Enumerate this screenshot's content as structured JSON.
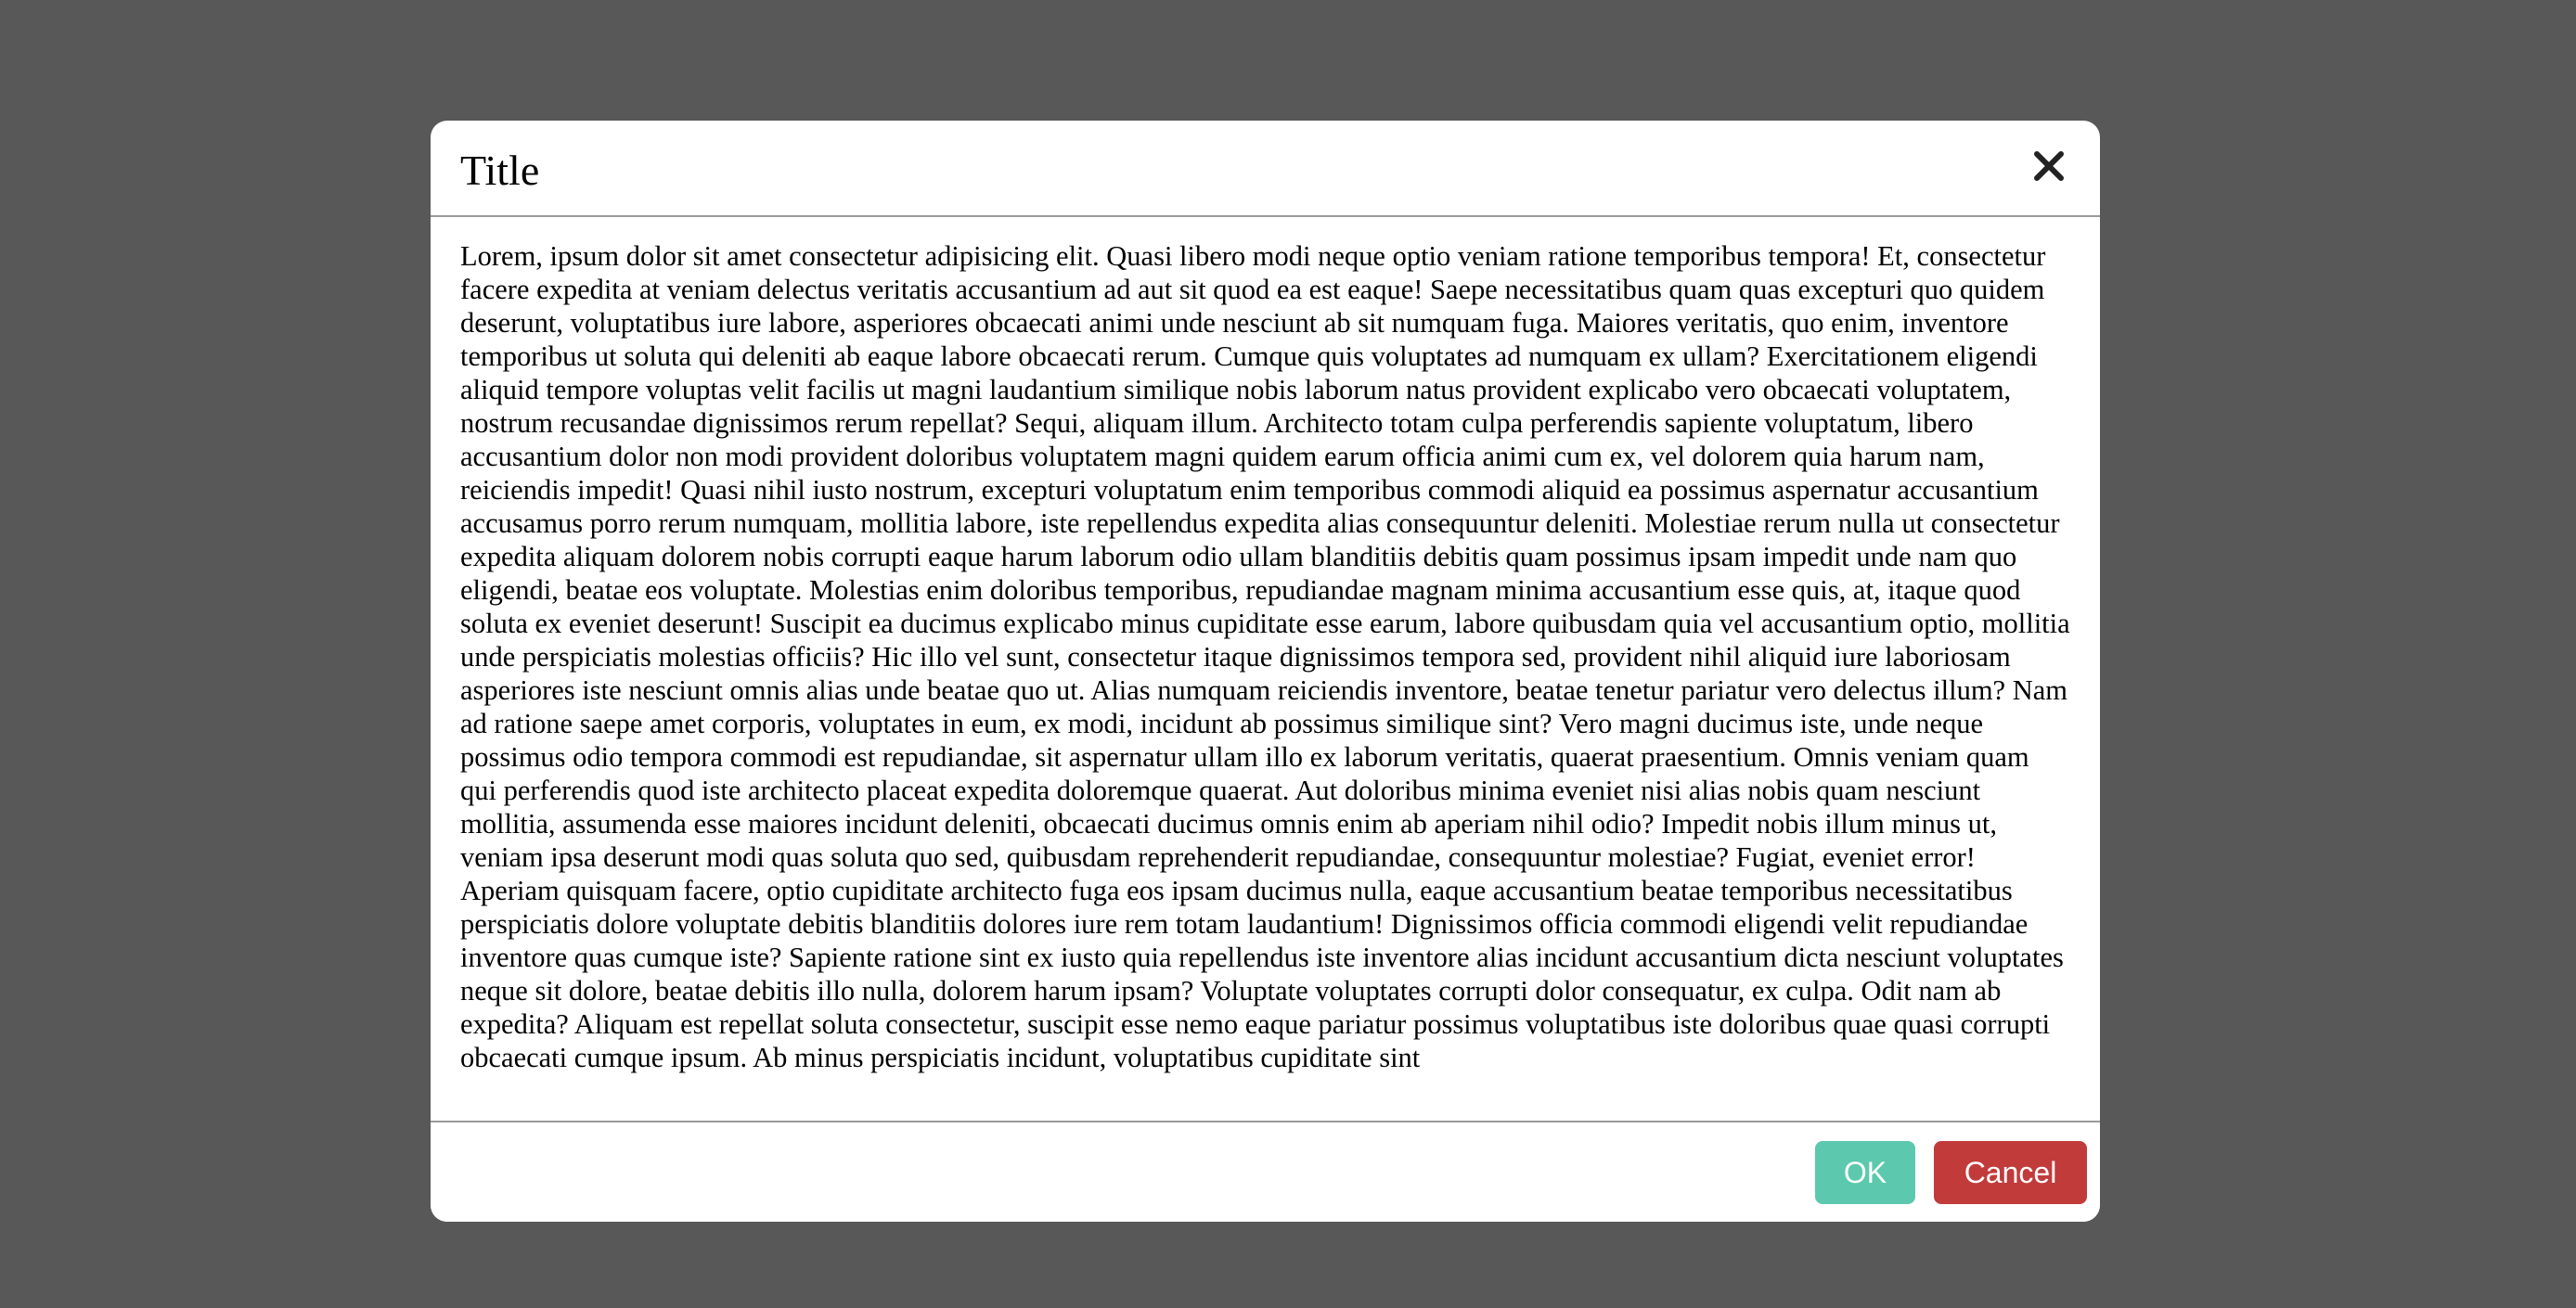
{
  "modal": {
    "title": "Title",
    "close_icon": "close-icon",
    "body_text": "Lorem, ipsum dolor sit amet consectetur adipisicing elit. Quasi libero modi neque optio veniam ratione temporibus tempora! Et, consectetur facere expedita at veniam delectus veritatis accusantium ad aut sit quod ea est eaque! Saepe necessitatibus quam quas excepturi quo quidem deserunt, voluptatibus iure labore, asperiores obcaecati animi unde nesciunt ab sit numquam fuga. Maiores veritatis, quo enim, inventore temporibus ut soluta qui deleniti ab eaque labore obcaecati rerum. Cumque quis voluptates ad numquam ex ullam? Exercitationem eligendi aliquid tempore voluptas velit facilis ut magni laudantium similique nobis laborum natus provident explicabo vero obcaecati voluptatem, nostrum recusandae dignissimos rerum repellat? Sequi, aliquam illum. Architecto totam culpa perferendis sapiente voluptatum, libero accusantium dolor non modi provident doloribus voluptatem magni quidem earum officia animi cum ex, vel dolorem quia harum nam, reiciendis impedit! Quasi nihil iusto nostrum, excepturi voluptatum enim temporibus commodi aliquid ea possimus aspernatur accusantium accusamus porro rerum numquam, mollitia labore, iste repellendus expedita alias consequuntur deleniti. Molestiae rerum nulla ut consectetur expedita aliquam dolorem nobis corrupti eaque harum laborum odio ullam blanditiis debitis quam possimus ipsam impedit unde nam quo eligendi, beatae eos voluptate. Molestias enim doloribus temporibus, repudiandae magnam minima accusantium esse quis, at, itaque quod soluta ex eveniet deserunt! Suscipit ea ducimus explicabo minus cupiditate esse earum, labore quibusdam quia vel accusantium optio, mollitia unde perspiciatis molestias officiis? Hic illo vel sunt, consectetur itaque dignissimos tempora sed, provident nihil aliquid iure laboriosam asperiores iste nesciunt omnis alias unde beatae quo ut. Alias numquam reiciendis inventore, beatae tenetur pariatur vero delectus illum? Nam ad ratione saepe amet corporis, voluptates in eum, ex modi, incidunt ab possimus similique sint? Vero magni ducimus iste, unde neque possimus odio tempora commodi est repudiandae, sit aspernatur ullam illo ex laborum veritatis, quaerat praesentium. Omnis veniam quam qui perferendis quod iste architecto placeat expedita doloremque quaerat. Aut doloribus minima eveniet nisi alias nobis quam nesciunt mollitia, assumenda esse maiores incidunt deleniti, obcaecati ducimus omnis enim ab aperiam nihil odio? Impedit nobis illum minus ut, veniam ipsa deserunt modi quas soluta quo sed, quibusdam reprehenderit repudiandae, consequuntur molestiae? Fugiat, eveniet error! Aperiam quisquam facere, optio cupiditate architecto fuga eos ipsam ducimus nulla, eaque accusantium beatae temporibus necessitatibus perspiciatis dolore voluptate debitis blanditiis dolores iure rem totam laudantium! Dignissimos officia commodi eligendi velit repudiandae inventore quas cumque iste? Sapiente ratione sint ex iusto quia repellendus iste inventore alias incidunt accusantium dicta nesciunt voluptates neque sit dolore, beatae debitis illo nulla, dolorem harum ipsam? Voluptate voluptates corrupti dolor consequatur, ex culpa. Odit nam ab expedita? Aliquam est repellat soluta consectetur, suscipit esse nemo eaque pariatur possimus voluptatibus iste doloribus quae quasi corrupti obcaecati cumque ipsum. Ab minus perspiciatis incidunt, voluptatibus cupiditate sint",
    "ok_label": "OK",
    "cancel_label": "Cancel"
  },
  "colors": {
    "backdrop": "#585858",
    "ok_button": "#5cc9ae",
    "cancel_button": "#c13b3b",
    "divider": "#9a9a9a"
  }
}
